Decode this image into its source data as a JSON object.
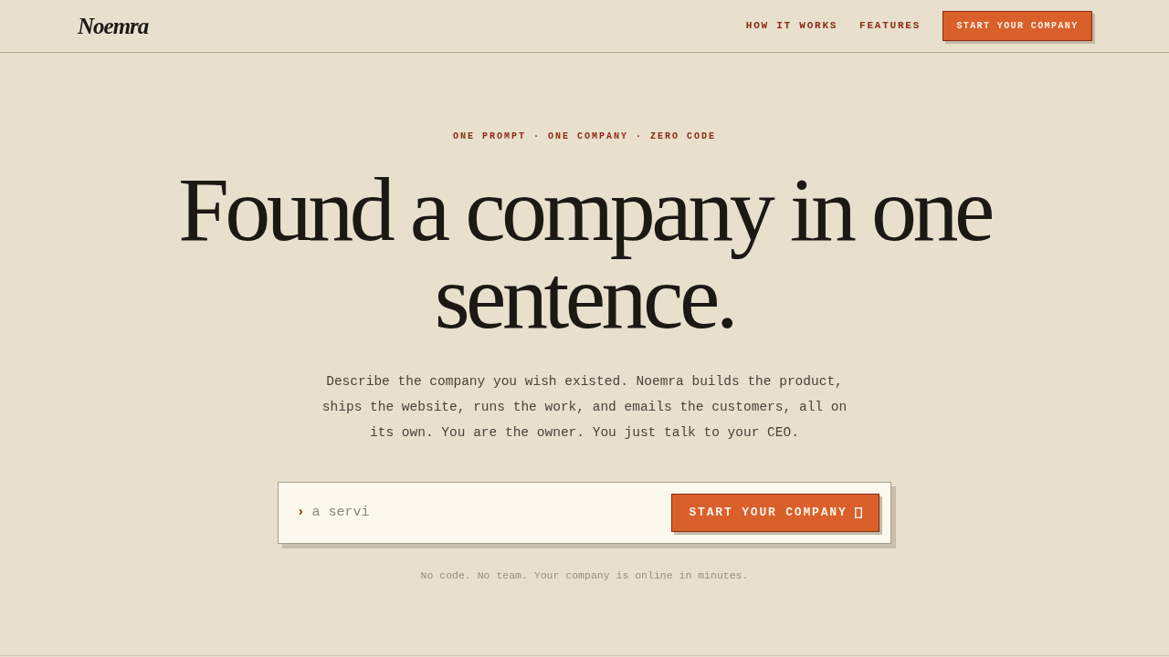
{
  "header": {
    "logo": "Noemra",
    "nav": [
      "HOW IT WORKS",
      "FEATURES"
    ],
    "cta": "START YOUR COMPANY"
  },
  "hero": {
    "eyebrow": "ONE PROMPT · ONE COMPANY · ZERO CODE",
    "headline": "Found a company in one sentence.",
    "description": "Describe the company you wish existed. Noemra builds the product, ships the website, runs the work, and emails the customers, all on its own. You are the owner. You just talk to your CEO.",
    "prompt": {
      "prompt_mark": "›",
      "placeholder": "a servi",
      "button": "START YOUR COMPANY"
    },
    "note": "No code. No team. Your company is online in minutes."
  }
}
